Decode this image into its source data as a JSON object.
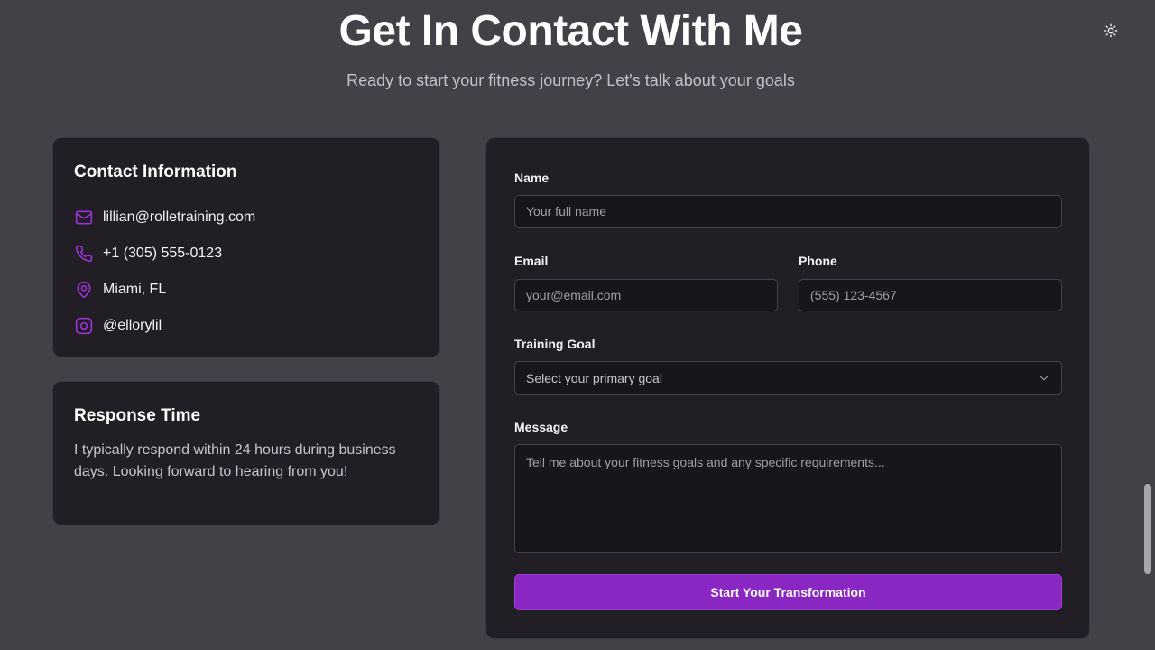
{
  "header": {
    "title": "Get In Contact With Me",
    "subtitle": "Ready to start your fitness journey? Let's talk about your goals",
    "theme_toggle_icon": "sun-icon"
  },
  "contact_info": {
    "heading": "Contact Information",
    "accent_color": "#9b32d6",
    "items": [
      {
        "icon": "mail-icon",
        "text": "lillian@rolletraining.com"
      },
      {
        "icon": "phone-icon",
        "text": "+1 (305) 555-0123"
      },
      {
        "icon": "map-pin-icon",
        "text": "Miami, FL"
      },
      {
        "icon": "instagram-icon",
        "text": "@ellorylil"
      }
    ]
  },
  "response_time": {
    "heading": "Response Time",
    "text": "I typically respond within 24 hours during business days. Looking forward to hearing from you!"
  },
  "form": {
    "name_label": "Name",
    "name_placeholder": "Your full name",
    "email_label": "Email",
    "email_placeholder": "your@email.com",
    "phone_label": "Phone",
    "phone_placeholder": "(555) 123-4567",
    "goal_label": "Training Goal",
    "goal_selected": "Select your primary goal",
    "message_label": "Message",
    "message_placeholder": "Tell me about your fitness goals and any specific requirements...",
    "submit_label": "Start Your Transformation",
    "submit_color": "#8a26c2"
  }
}
